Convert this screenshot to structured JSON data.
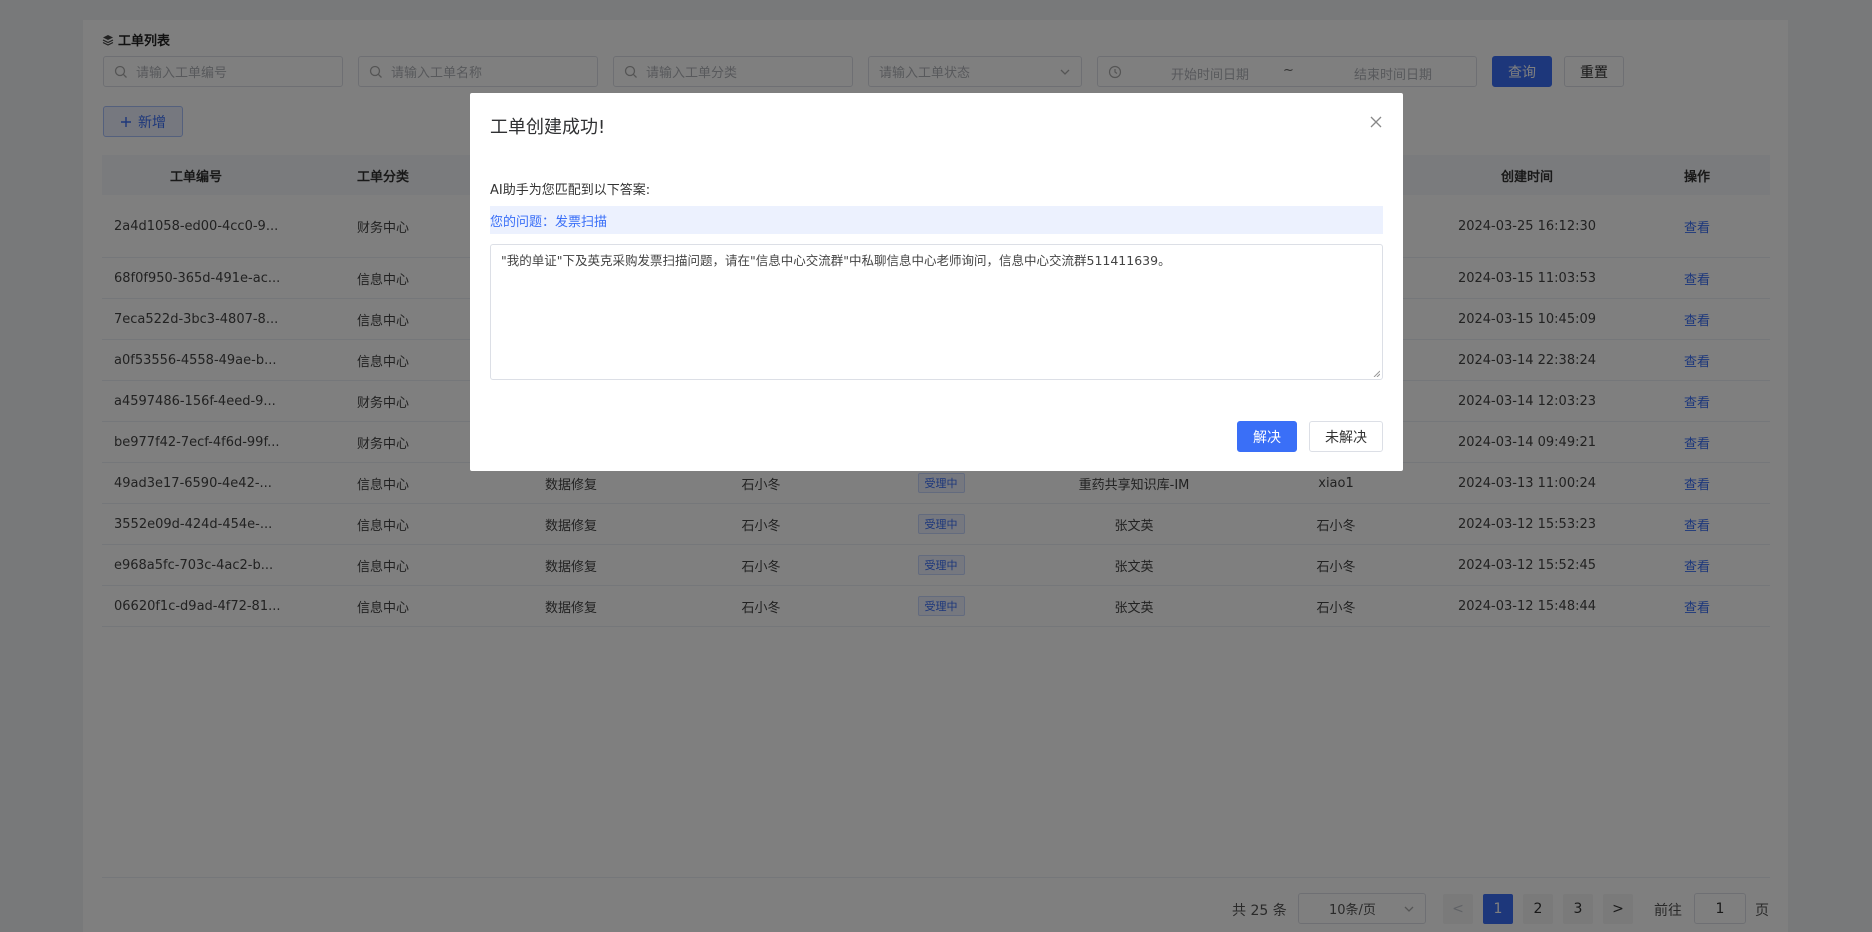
{
  "section_title": "工单列表",
  "search": {
    "order_no_placeholder": "请输入工单编号",
    "order_name_placeholder": "请输入工单名称",
    "order_category_placeholder": "请输入工单分类",
    "order_status_placeholder": "请输入工单状态",
    "start_date_placeholder": "开始时间日期",
    "range_separator": "~",
    "end_date_placeholder": "结束时间日期",
    "query_label": "查询",
    "reset_label": "重置"
  },
  "add_label": "新增",
  "table": {
    "headers": [
      "工单编号",
      "工单分类",
      "",
      "",
      "",
      "",
      "",
      "创建时间",
      "操作"
    ],
    "rows": [
      {
        "id": "2a4d1058-ed00-4cc0-9...",
        "category": "财务中心",
        "type": "",
        "handler": "",
        "status": "",
        "kb": "",
        "creator": "",
        "created": "2024-03-25 16:12:30",
        "action": "查看"
      },
      {
        "id": "68f0f950-365d-491e-ac...",
        "category": "信息中心",
        "type": "",
        "handler": "",
        "status": "",
        "kb": "",
        "creator": "",
        "created": "2024-03-15 11:03:53",
        "action": "查看"
      },
      {
        "id": "7eca522d-3bc3-4807-8...",
        "category": "信息中心",
        "type": "",
        "handler": "",
        "status": "",
        "kb": "",
        "creator": "",
        "created": "2024-03-15 10:45:09",
        "action": "查看"
      },
      {
        "id": "a0f53556-4558-49ae-b...",
        "category": "信息中心",
        "type": "",
        "handler": "",
        "status": "",
        "kb": "",
        "creator": "",
        "created": "2024-03-14 22:38:24",
        "action": "查看"
      },
      {
        "id": "a4597486-156f-4eed-9...",
        "category": "财务中心",
        "type": "",
        "handler": "",
        "status": "",
        "kb": "",
        "creator": "",
        "created": "2024-03-14 12:03:23",
        "action": "查看"
      },
      {
        "id": "be977f42-7ecf-4f6d-99f...",
        "category": "财务中心",
        "type": "",
        "handler": "",
        "status": "",
        "kb": "",
        "creator": "",
        "created": "2024-03-14 09:49:21",
        "action": "查看"
      },
      {
        "id": "49ad3e17-6590-4e42-...",
        "category": "信息中心",
        "type": "数据修复",
        "handler": "石小冬",
        "status": "受理中",
        "kb": "重药共享知识库-IM",
        "creator": "xiao1",
        "created": "2024-03-13 11:00:24",
        "action": "查看"
      },
      {
        "id": "3552e09d-424d-454e-...",
        "category": "信息中心",
        "type": "数据修复",
        "handler": "石小冬",
        "status": "受理中",
        "kb": "张文英",
        "creator": "石小冬",
        "created": "2024-03-12 15:53:23",
        "action": "查看"
      },
      {
        "id": "e968a5fc-703c-4ac2-b...",
        "category": "信息中心",
        "type": "数据修复",
        "handler": "石小冬",
        "status": "受理中",
        "kb": "张文英",
        "creator": "石小冬",
        "created": "2024-03-12 15:52:45",
        "action": "查看"
      },
      {
        "id": "06620f1c-d9ad-4f72-81...",
        "category": "信息中心",
        "type": "数据修复",
        "handler": "石小冬",
        "status": "受理中",
        "kb": "张文英",
        "creator": "石小冬",
        "created": "2024-03-12 15:48:44",
        "action": "查看"
      }
    ]
  },
  "pagination": {
    "total": "共 25 条",
    "page_size": "10条/页",
    "pages": [
      "1",
      "2",
      "3"
    ],
    "prev": "<",
    "next": ">",
    "goto_label": "前往",
    "goto_value": "1",
    "page_suffix": "页"
  },
  "modal": {
    "title": "工单创建成功!",
    "subtitle": "AI助手为您匹配到以下答案:",
    "question": "您的问题：发票扫描",
    "answer": "\"我的单证\"下及英克采购发票扫描问题，请在\"信息中心交流群\"中私聊信息中心老师询问，信息中心交流群511411639。",
    "resolved_label": "解决",
    "unresolved_label": "未解决"
  },
  "colors": {
    "primary": "#3a6ff7",
    "mask": "rgba(0,0,0,0.5)"
  }
}
